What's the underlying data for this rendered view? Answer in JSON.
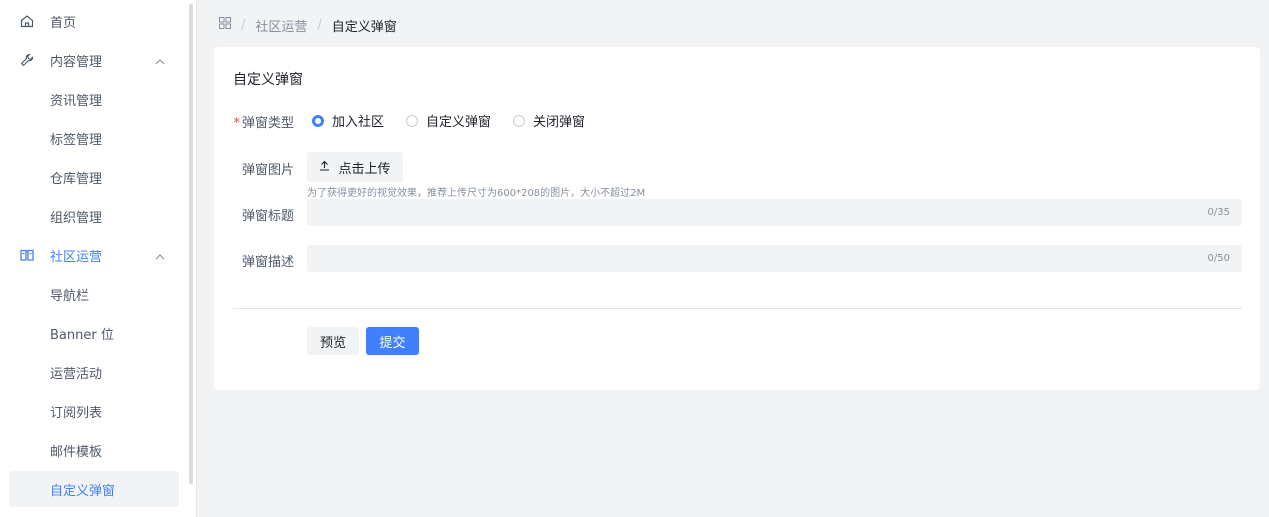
{
  "sidebar": {
    "items": [
      {
        "label": "首页",
        "icon": "home-icon"
      },
      {
        "label": "内容管理",
        "icon": "wrench-icon",
        "expanded": true
      },
      {
        "label": "资讯管理"
      },
      {
        "label": "标签管理"
      },
      {
        "label": "仓库管理"
      },
      {
        "label": "组织管理"
      },
      {
        "label": "社区运营",
        "icon": "book-icon",
        "expanded": true
      },
      {
        "label": "导航栏"
      },
      {
        "label": "Banner 位"
      },
      {
        "label": "运营活动"
      },
      {
        "label": "订阅列表"
      },
      {
        "label": "邮件模板"
      },
      {
        "label": "自定义弹窗",
        "selected": true
      }
    ]
  },
  "breadcrumb": {
    "icon": "apps-grid-icon",
    "items": [
      "社区运营",
      "自定义弹窗"
    ],
    "separator": "/"
  },
  "card": {
    "title": "自定义弹窗",
    "type_field": {
      "label": "弹窗类型",
      "required_mark": "*",
      "options": [
        "加入社区",
        "自定义弹窗",
        "关闭弹窗"
      ],
      "selected": "加入社区"
    },
    "image_field": {
      "label": "弹窗图片",
      "upload_label": "点击上传",
      "hint": "为了获得更好的视觉效果，推荐上传尺寸为600*208的图片，大小不超过2M"
    },
    "title_field": {
      "label": "弹窗标题",
      "value": "",
      "counter": "0/35"
    },
    "desc_field": {
      "label": "弹窗描述",
      "value": "",
      "counter": "0/50"
    },
    "buttons": {
      "preview": "预览",
      "submit": "提交"
    }
  },
  "colors": {
    "primary": "#4080ff",
    "required": "#f53f3f",
    "input_bg": "#f2f3f5"
  }
}
